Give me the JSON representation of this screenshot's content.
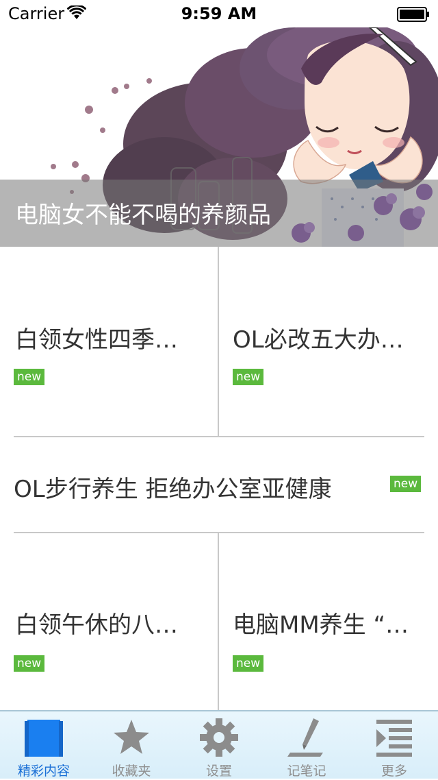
{
  "status_bar": {
    "carrier": "Carrier",
    "time": "9:59 AM"
  },
  "hero": {
    "caption": "电脑女不能不喝的养颜品"
  },
  "articles": {
    "top_left": {
      "title": "白领女性四季…",
      "badge": "new"
    },
    "top_right": {
      "title": "OL必改五大办…",
      "badge": "new"
    },
    "middle": {
      "title": "OL步行养生 拒绝办公室亚健康",
      "badge": "new"
    },
    "bottom_left": {
      "title": "白领午休的八…",
      "badge": "new"
    },
    "bottom_right": {
      "title": "电脑MM养生 “…",
      "badge": "new"
    }
  },
  "tab_bar": {
    "tabs": [
      {
        "label": "精彩内容",
        "icon": "content-book-icon",
        "active": true
      },
      {
        "label": "收藏夹",
        "icon": "star-icon",
        "active": false
      },
      {
        "label": "设置",
        "icon": "gear-icon",
        "active": false
      },
      {
        "label": "记笔记",
        "icon": "pen-icon",
        "active": false
      },
      {
        "label": "更多",
        "icon": "more-list-icon",
        "active": false
      }
    ]
  },
  "colors": {
    "badge": "#5bb93d",
    "active_tab": "#1a6fd6",
    "inactive_tab": "#8f8f8f",
    "tab_bar_bg": "#e3f3fb"
  }
}
